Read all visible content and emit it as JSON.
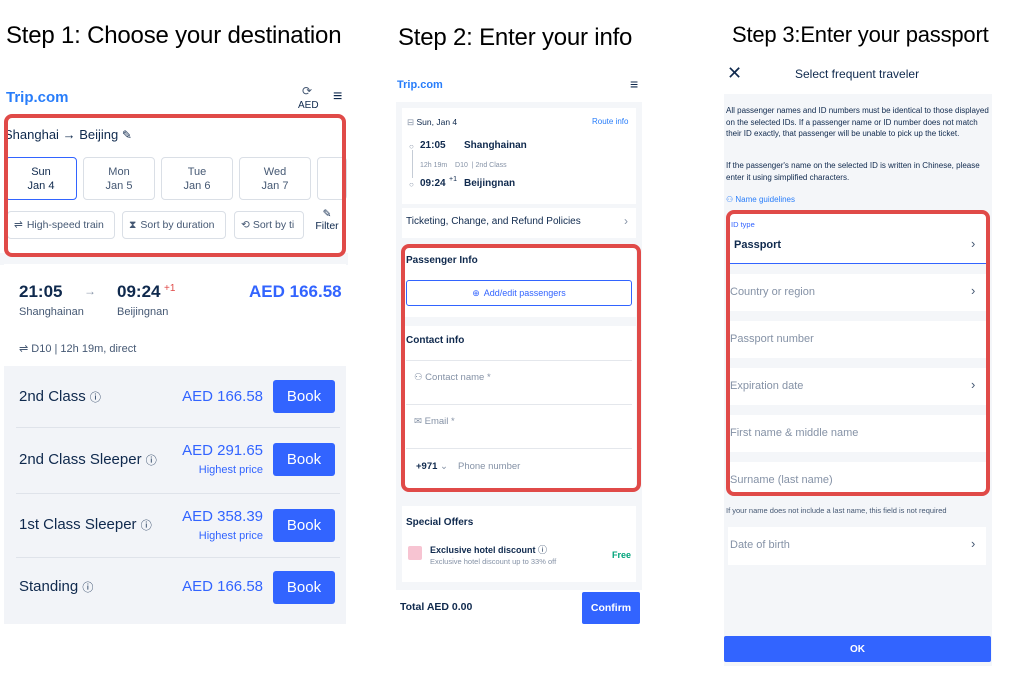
{
  "steps": {
    "step1": "Step 1: Choose your destination",
    "step2": "Step 2: Enter your info",
    "step3": "Step 3:Enter your passport"
  },
  "panel1": {
    "logo": "Trip.com",
    "currency": "AED",
    "route": {
      "from": "Shanghai",
      "arrow": "→",
      "to": "Beijing"
    },
    "dates": [
      {
        "day": "Sun",
        "date": "Jan 4",
        "selected": true
      },
      {
        "day": "Mon",
        "date": "Jan 5",
        "selected": false
      },
      {
        "day": "Tue",
        "date": "Jan 6",
        "selected": false
      },
      {
        "day": "Wed",
        "date": "Jan 7",
        "selected": false
      }
    ],
    "filters": {
      "high_speed": "High-speed train",
      "sort_duration": "Sort by duration",
      "sort_time": "Sort by ti",
      "filter": "Filter"
    },
    "train": {
      "depart_time": "21:05",
      "arrive_time": "09:24",
      "day_offset": "+1",
      "depart_station": "Shanghainan",
      "arrive_station": "Beijingnan",
      "price": "AED 166.58",
      "info": "D10 | 12h 19m, direct"
    },
    "classes": [
      {
        "name": "2nd Class",
        "price": "AED 166.58",
        "note": "",
        "button": "Book"
      },
      {
        "name": "2nd Class Sleeper",
        "price": "AED 291.65",
        "note": "Highest price",
        "button": "Book"
      },
      {
        "name": "1st Class Sleeper",
        "price": "AED 358.39",
        "note": "Highest price",
        "button": "Book"
      },
      {
        "name": "Standing",
        "price": "AED 166.58",
        "note": "",
        "button": "Book"
      }
    ]
  },
  "panel2": {
    "logo": "Trip.com",
    "date": "Sun, Jan 4",
    "route_info": "Route info",
    "depart_time": "21:05",
    "depart_station": "Shanghainan",
    "duration": "12h 19m",
    "train_no": "D10",
    "seat_class": "2nd Class",
    "arrive_time": "09:24",
    "day_offset": "+1",
    "arrive_station": "Beijingnan",
    "policies": "Ticketing, Change, and Refund Policies",
    "passenger_info": "Passenger Info",
    "add_passengers": "Add/edit passengers",
    "contact_info": "Contact info",
    "contact_name_placeholder": "Contact name *",
    "email_placeholder": "Email *",
    "phone_code": "+971",
    "phone_placeholder": "Phone number",
    "special_offers": "Special Offers",
    "hotel_title": "Exclusive hotel discount",
    "hotel_sub": "Exclusive hotel discount up to 33% off",
    "hotel_badge": "Free",
    "total_label": "Total",
    "total_value": "AED 0.00",
    "confirm": "Confirm"
  },
  "panel3": {
    "title": "Select frequent traveler",
    "notice1": "All passenger names and ID numbers must be identical to those displayed on the selected IDs. If a passenger name or ID number does not match their ID exactly, that passenger will be unable to pick up the ticket.",
    "notice2": "If the passenger's name on the selected ID is written in Chinese, please enter it using simplified characters.",
    "name_guidelines": "Name guidelines",
    "id_type_label": "ID type",
    "id_type_value": "Passport",
    "country": "Country or region",
    "passport_number": "Passport number",
    "expiration": "Expiration date",
    "first_name": "First name & middle name",
    "surname": "Surname (last name)",
    "last_name_note": "If your name does not include a last name, this field is not required",
    "dob": "Date of birth",
    "ok": "OK"
  },
  "colors": {
    "accent": "#3264ff",
    "highlight": "#e04a48",
    "text": "#0f294d"
  }
}
